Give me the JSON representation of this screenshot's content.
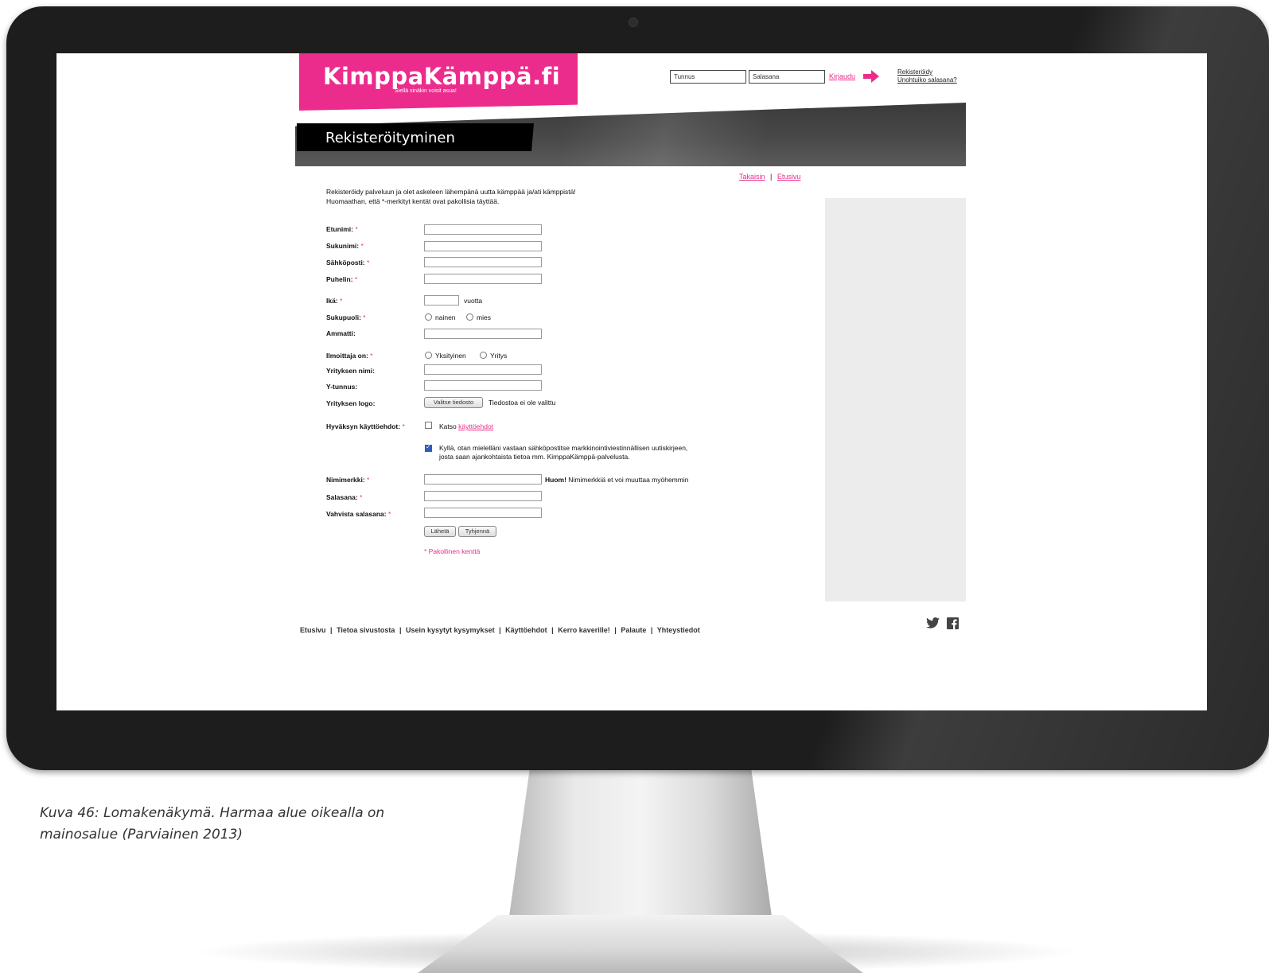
{
  "caption": "Kuva 46: Lomakenäkymä. Harmaa alue oikealla on mainosalue (Parviainen 2013)",
  "site": {
    "logo": "KimppaKämppä.fi",
    "slogan": "Siellä sinäkin voisit asua!",
    "login": {
      "username_placeholder": "Tunnus",
      "password_placeholder": "Salasana",
      "login_link": "Kirjaudu",
      "register_link": "Rekisteröidy",
      "forgot_link": "Unohtuiko salasana?"
    },
    "page_title": "Rekisteröityminen",
    "nav": {
      "back": "Takaisin",
      "separator": "|",
      "home": "Etusivu"
    },
    "intro_line1": "Rekisteröidy palveluun ja olet askeleen lähempänä uutta kämppää ja/ati kämppistä!",
    "intro_line2": "Huomaathan, että *-merkityt kentät ovat pakollisia täyttää.",
    "required_mark": "*",
    "form": {
      "first_name": "Etunimi:",
      "last_name": "Sukunimi:",
      "email": "Sähköposti:",
      "phone": "Puhelin:",
      "age": "Ikä:",
      "age_unit": "vuotta",
      "gender": "Sukupuoli:",
      "gender_female": "nainen",
      "gender_male": "mies",
      "profession": "Ammatti:",
      "advertiser": "Ilmoittaja on:",
      "advertiser_private": "Yksityinen",
      "advertiser_company": "Yritys",
      "company_name": "Yrityksen nimi:",
      "business_id": "Y-tunnus:",
      "company_logo": "Yrityksen logo:",
      "choose_file_button": "Valitse tiedosto",
      "no_file_text": "Tiedostoa ei ole valittu",
      "terms": "Hyväksyn käyttöehdot:",
      "see_text": "Katso",
      "terms_link": "käyttöehdot",
      "newsletter_line1": "Kyllä, otan mielelläni vastaan sähköpostitse markkinointiviestinnällisen uutiskirjeen,",
      "newsletter_line2": "josta saan ajankohtaista tietoa mm. KimppaKämppä-palvelusta.",
      "newsletter_checked": true,
      "nickname": "Nimimerkki:",
      "nickname_note_bold": "Huom!",
      "nickname_note": "Nimimerkkiä et voi muuttaa myöhemmin",
      "password": "Salasana:",
      "confirm_password": "Vahvista salasana:",
      "submit_button": "Lähetä",
      "clear_button": "Tyhjennä",
      "required_note": "* Pakollinen kenttä"
    },
    "footer": {
      "items": [
        "Etusivu",
        "Tietoa sivustosta",
        "Usein kysytyt kysymykset",
        "Käyttöehdot",
        "Kerro kaverille!",
        "Palaute",
        "Yhteystiedot"
      ],
      "separator": "|"
    }
  }
}
